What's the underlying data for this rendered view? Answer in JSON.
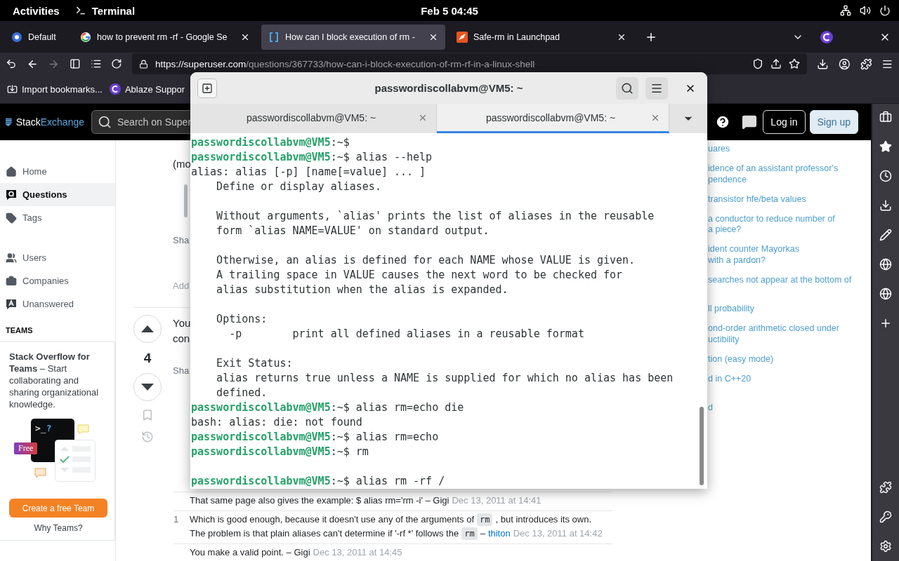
{
  "top_bar": {
    "activities": "Activities",
    "app": "Terminal",
    "clock": "Feb 5  04:45"
  },
  "browser": {
    "tabs": [
      {
        "title": "Default",
        "selected": false
      },
      {
        "title": "how to prevent rm -rf - Google Se",
        "selected": false
      },
      {
        "title": "How can I block execution of rm -",
        "selected": true
      },
      {
        "title": "Safe-rm in Launchpad",
        "selected": false
      }
    ],
    "url": {
      "host": "https://superuser.com",
      "path": "/questions/367733/how-can-i-block-execution-of-rm-rf-in-a-linux-shell"
    },
    "bookmarks": [
      {
        "label": "Import bookmarks..."
      },
      {
        "label": "Ablaze Suppor"
      }
    ]
  },
  "site": {
    "logo": {
      "first": "Stack",
      "second": "Exchange"
    },
    "search": {
      "placeholder": "Search on Super"
    },
    "login": "Log in",
    "signup": "Sign up",
    "nav_groups": [
      [
        {
          "label": "Home",
          "selected": false
        },
        {
          "label": "Questions",
          "selected": true
        },
        {
          "label": "Tags",
          "selected": false
        }
      ],
      [
        {
          "label": "Users",
          "selected": false
        },
        {
          "label": "Companies",
          "selected": false
        },
        {
          "label": "Unanswered",
          "selected": false
        }
      ]
    ],
    "teams": {
      "heading": "TEAMS",
      "text": "**Stack Overflow for Teams** – Start collaborating and sharing organizational knowledge.",
      "prompt_symbol": ">_",
      "prompt_mark": "?",
      "badge": "Free",
      "button": "Create a free Team",
      "link": "Why Teams?"
    },
    "first_post": {
      "text": "(mo",
      "share": "Sha",
      "add_comment": "Add"
    },
    "second_post": {
      "score": "4",
      "text_lines": [
        "You",
        "con"
      ],
      "share": "Sha",
      "comments": [
        {
          "parts": [
            {
              "kind": "text",
              "text": "That same page also gives the example: $ alias rm='rm -i' – Gigi"
            },
            {
              "kind": "date",
              "text": "Dec 13, 2011 at 14:41"
            }
          ]
        },
        {
          "score": "1",
          "parts": [
            {
              "kind": "text",
              "text": "Which is good enough, because it doesn't use any of the arguments of"
            },
            {
              "kind": "code",
              "text": "rm"
            },
            {
              "kind": "text",
              "text": ", but introduces its own."
            },
            {
              "kind": "break"
            },
            {
              "kind": "text",
              "text": "The problem is that plain aliases can't determine if '-rf *' follows the"
            },
            {
              "kind": "code",
              "text": "rm"
            },
            {
              "kind": "text",
              "text": "–"
            },
            {
              "kind": "user",
              "text": "thiton"
            },
            {
              "kind": "date",
              "text": "Dec 13, 2011 at 14:42"
            }
          ]
        },
        {
          "parts": [
            {
              "kind": "text",
              "text": "You make a valid point. – Gigi"
            },
            {
              "kind": "date",
              "text": "Dec 13, 2011 at 14:45"
            }
          ]
        }
      ]
    },
    "related": [
      {
        "lines": [
          "uares"
        ]
      },
      {
        "lines": [
          "idence of an assistant professor's",
          "pendence"
        ]
      },
      {
        "lines": [
          "transistor hfe/beta values"
        ]
      },
      {
        "lines": [
          "a conductor to reduce number of",
          "a piece?"
        ]
      },
      {
        "lines": [
          "ident counter Mayorkas",
          "with a pardon?"
        ]
      },
      {
        "lines": [
          "searches not appear at the bottom of"
        ]
      },
      {
        "lines": [
          "ll probability"
        ]
      },
      {
        "lines": [
          "ond-order arithmetic closed under",
          "uctibility"
        ]
      },
      {
        "lines": [
          "tion (easy mode)"
        ]
      },
      {
        "lines": [
          "d in C++20"
        ]
      },
      {
        "lines": [
          "d"
        ]
      }
    ]
  },
  "terminal": {
    "title": "passwordiscollabvm@VM5: ~",
    "tabs": [
      {
        "title": "passwordiscollabvm@VM5: ~",
        "selected": false
      },
      {
        "title": "passwordiscollabvm@VM5: ~",
        "selected": true
      }
    ],
    "lines": [
      {
        "kind": "prompt",
        "user": "passwordiscollabvm@VM5",
        "path": ":~$"
      },
      {
        "kind": "prompt",
        "user": "passwordiscollabvm@VM5",
        "path": ":~$",
        "command": "alias --help"
      },
      {
        "kind": "output",
        "text": "alias: alias [-p] [name[=value] ... ]"
      },
      {
        "kind": "output",
        "text": "    Define or display aliases."
      },
      {
        "kind": "blank"
      },
      {
        "kind": "output",
        "text": "    Without arguments, `alias' prints the list of aliases in the reusable"
      },
      {
        "kind": "output",
        "text": "    form `alias NAME=VALUE' on standard output."
      },
      {
        "kind": "blank"
      },
      {
        "kind": "output",
        "text": "    Otherwise, an alias is defined for each NAME whose VALUE is given."
      },
      {
        "kind": "output",
        "text": "    A trailing space in VALUE causes the next word to be checked for"
      },
      {
        "kind": "output",
        "text": "    alias substitution when the alias is expanded."
      },
      {
        "kind": "blank"
      },
      {
        "kind": "output",
        "text": "    Options:"
      },
      {
        "kind": "output",
        "text": "      -p        print all defined aliases in a reusable format"
      },
      {
        "kind": "blank"
      },
      {
        "kind": "output",
        "text": "    Exit Status:"
      },
      {
        "kind": "output",
        "text": "    alias returns true unless a NAME is supplied for which no alias has been"
      },
      {
        "kind": "output",
        "text": "    defined."
      },
      {
        "kind": "prompt",
        "user": "passwordiscollabvm@VM5",
        "path": ":~$",
        "command": "alias rm=echo die"
      },
      {
        "kind": "output",
        "text": "bash: alias: die: not found"
      },
      {
        "kind": "prompt",
        "user": "passwordiscollabvm@VM5",
        "path": ":~$",
        "command": "alias rm=echo"
      },
      {
        "kind": "prompt",
        "user": "passwordiscollabvm@VM5",
        "path": ":~$",
        "command": "rm"
      },
      {
        "kind": "blank"
      },
      {
        "kind": "prompt",
        "user": "passwordiscollabvm@VM5",
        "path": ":~$",
        "command": "alias rm -rf /"
      }
    ]
  }
}
